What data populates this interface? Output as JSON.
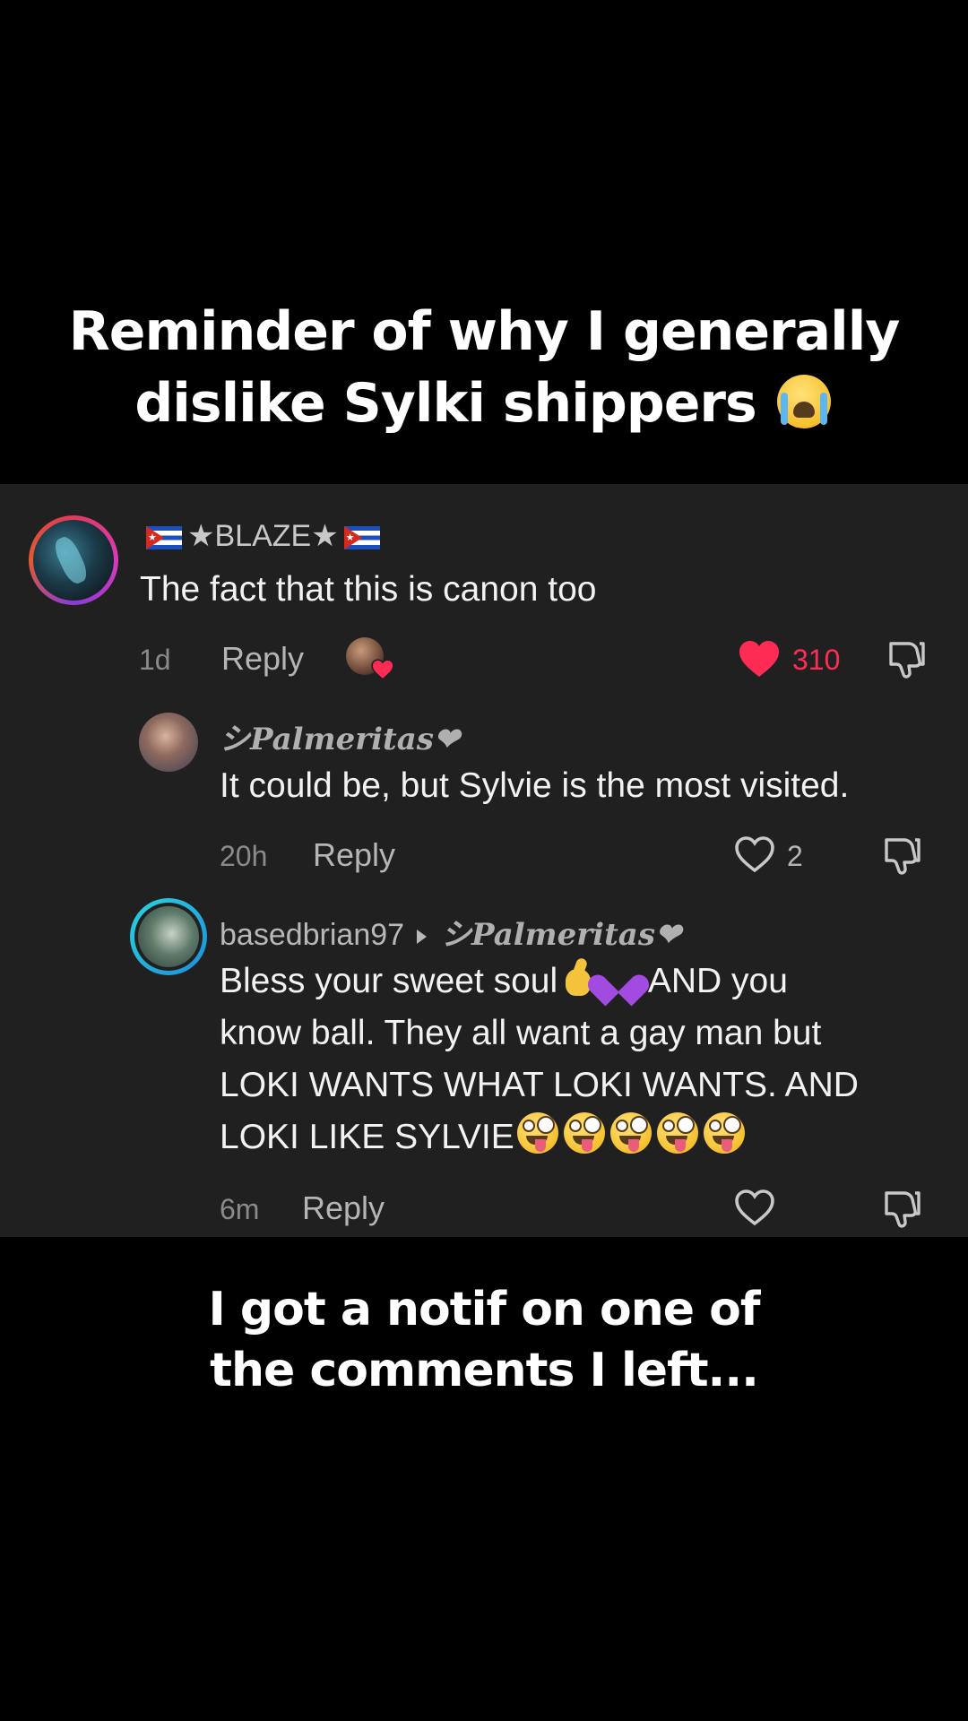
{
  "captions": {
    "top_line1": "Reminder of why I generally",
    "top_line2": "dislike Sylki shippers",
    "top_emoji": "loudly-crying-face-emoji",
    "bottom_line1": "I got a notif on one of",
    "bottom_line2": "the comments I left..."
  },
  "comments": [
    {
      "username": "★BLAZE★",
      "username_prefix_icon": "cuba-flag-icon",
      "username_suffix_icon": "cuba-flag-icon",
      "text": "The fact that this is canon too",
      "time": "1d",
      "reply_label": "Reply",
      "likes": "310",
      "liked": true,
      "creator_liked": true
    },
    {
      "username": "シPalmeritas❤",
      "text": "It could be, but Sylvie is the most visited.",
      "time": "20h",
      "reply_label": "Reply",
      "likes": "2",
      "liked": false
    },
    {
      "username": "basedbrian97",
      "reply_to": "シPalmeritas❤",
      "text_part1": "Bless your sweet soul",
      "text_part2": "AND you",
      "text_line2": "know ball. They all want a gay man but",
      "text_line3": "LOKI WANTS WHAT LOKI WANTS. AND",
      "text_line4": "LOKI LIKE SYLVIE",
      "emojis_inline": [
        "crossed-fingers-emoji",
        "purple-heart-emoji"
      ],
      "emojis_trailing": [
        "zany-face-emoji",
        "zany-face-emoji",
        "zany-face-emoji",
        "zany-face-emoji",
        "zany-face-emoji"
      ],
      "time": "6m",
      "reply_label": "Reply",
      "likes": "",
      "liked": false
    }
  ],
  "colors": {
    "background": "#000000",
    "panel": "#202020",
    "like_active": "#fe2c55",
    "text_primary": "#f2f2f2",
    "text_secondary": "#8a8a8a"
  }
}
